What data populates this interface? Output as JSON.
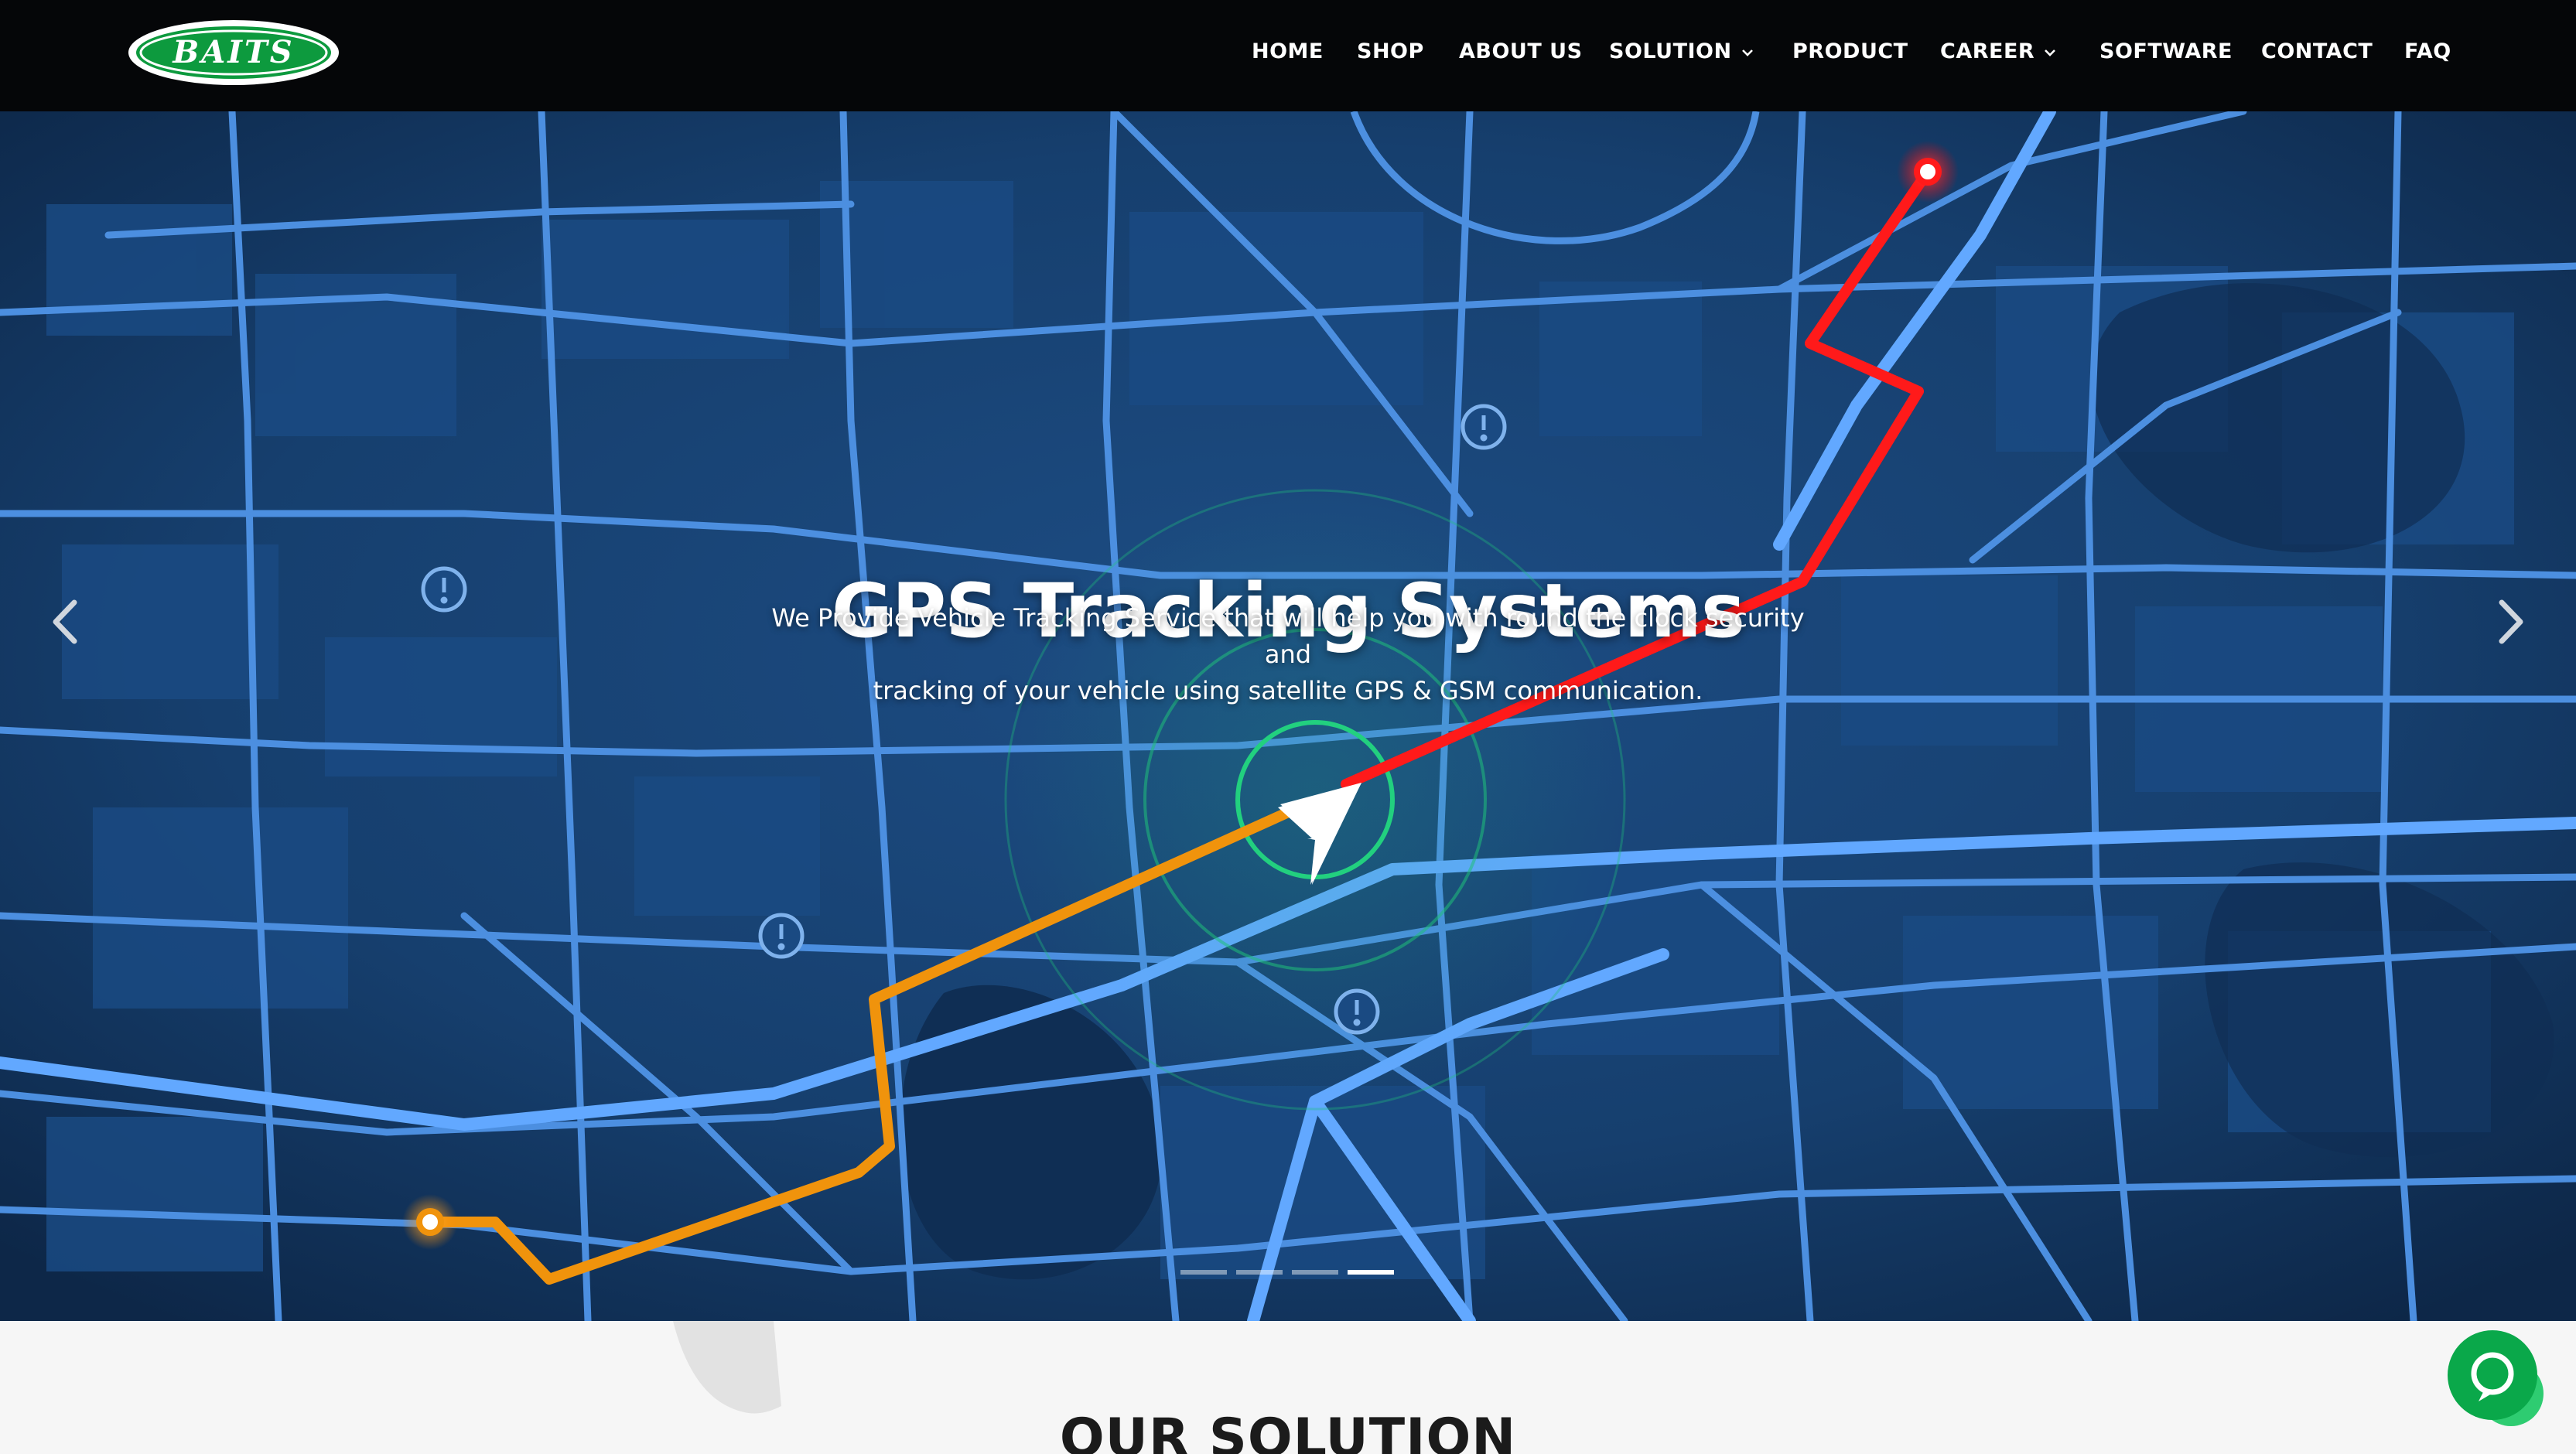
{
  "brand": {
    "logo_text": "BAITS",
    "logo_green": "#0d9a3e"
  },
  "nav": {
    "items": [
      {
        "label": "HOME",
        "dropdown": false
      },
      {
        "label": "SHOP",
        "dropdown": false
      },
      {
        "label": "ABOUT US",
        "dropdown": false
      },
      {
        "label": "SOLUTION",
        "dropdown": true
      },
      {
        "label": "PRODUCT",
        "dropdown": false
      },
      {
        "label": "CAREER",
        "dropdown": true
      },
      {
        "label": "SOFTWARE",
        "dropdown": false
      },
      {
        "label": "CONTACT",
        "dropdown": false
      },
      {
        "label": "FAQ",
        "dropdown": false
      }
    ]
  },
  "hero": {
    "title": "GPS Tracking Systems",
    "description_line1": "We Provide Vehicle Tracking Service that will help you with round the clock security and",
    "description_line2": "tracking of your vehicle using satellite GPS & GSM communication.",
    "prev_icon": "chevron-left-icon",
    "next_icon": "chevron-right-icon",
    "slides_total": 4,
    "active_slide": 4,
    "colors": {
      "map_bg": "#143a66",
      "roads": "#4c8fe0",
      "route_active": "#ff1a1a",
      "route_past": "#f0930c",
      "radar": "#1fbf7a"
    }
  },
  "section": {
    "heading": "OUR SOLUTION"
  },
  "chat": {
    "icon": "chat-bubble-icon",
    "color": "#0aa84a"
  }
}
